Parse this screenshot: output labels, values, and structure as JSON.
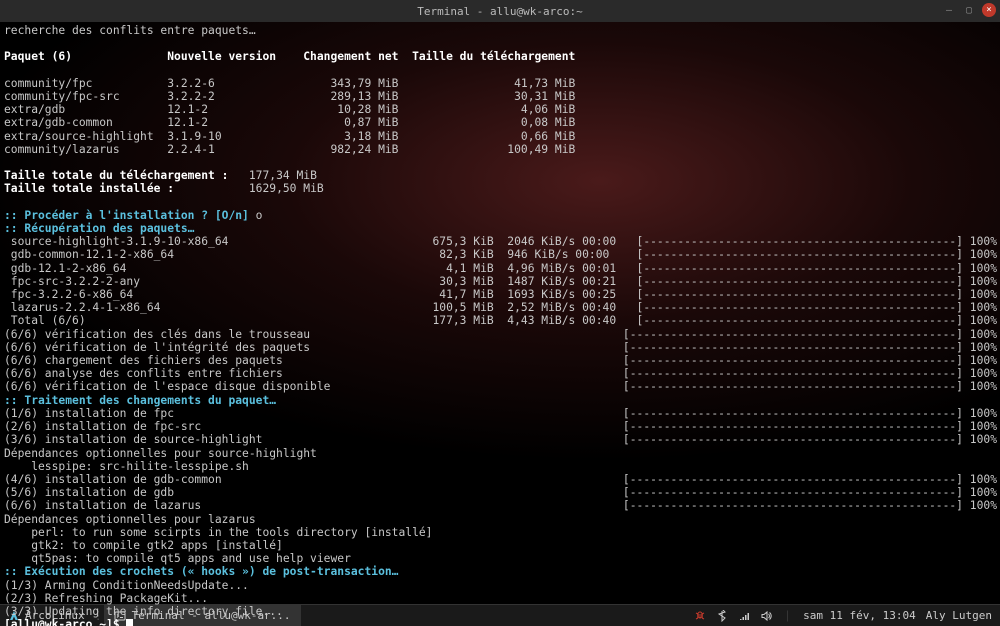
{
  "window_title": "Terminal - allu@wk-arco:~",
  "search_line": "recherche des conflits entre paquets…",
  "pkg_table": {
    "header": [
      "Paquet (6)",
      "Nouvelle version",
      "Changement net",
      "Taille du téléchargement"
    ],
    "rows": [
      [
        "community/fpc",
        "3.2.2-6",
        "343,79 MiB",
        "41,73 MiB"
      ],
      [
        "community/fpc-src",
        "3.2.2-2",
        "289,13 MiB",
        "30,31 MiB"
      ],
      [
        "extra/gdb",
        "12.1-2",
        "10,28 MiB",
        "4,06 MiB"
      ],
      [
        "extra/gdb-common",
        "12.1-2",
        "0,87 MiB",
        "0,08 MiB"
      ],
      [
        "extra/source-highlight",
        "3.1.9-10",
        "3,18 MiB",
        "0,66 MiB"
      ],
      [
        "community/lazarus",
        "2.2.4-1",
        "982,24 MiB",
        "100,49 MiB"
      ]
    ]
  },
  "totals": [
    [
      "Taille totale du téléchargement :",
      "177,34 MiB"
    ],
    [
      "Taille totale installée :",
      "1629,50 MiB"
    ]
  ],
  "prompt_install": ":: Procéder à l'installation ? [O/n] ",
  "prompt_answer": "o",
  "retrieval_header": ":: Récupération des paquets…",
  "downloads": [
    [
      "source-highlight-3.1.9-10-x86_64",
      "675,3 KiB",
      "2046 KiB/s 00:00"
    ],
    [
      "gdb-common-12.1-2-x86_64",
      "82,3 KiB",
      "946 KiB/s 00:00"
    ],
    [
      "gdb-12.1-2-x86_64",
      "4,1 MiB",
      "4,96 MiB/s 00:01"
    ],
    [
      "fpc-src-3.2.2-2-any",
      "30,3 MiB",
      "1487 KiB/s 00:21"
    ],
    [
      "fpc-3.2.2-6-x86_64",
      "41,7 MiB",
      "1693 KiB/s 00:25"
    ],
    [
      "lazarus-2.2.4-1-x86_64",
      "100,5 MiB",
      "2,52 MiB/s 00:40"
    ],
    [
      "Total (6/6)",
      "177,3 MiB",
      "4,43 MiB/s 00:40"
    ]
  ],
  "checks": [
    "(6/6) vérification des clés dans le trousseau",
    "(6/6) vérification de l'intégrité des paquets",
    "(6/6) chargement des fichiers des paquets",
    "(6/6) analyse des conflits entre fichiers",
    "(6/6) vérification de l'espace disque disponible"
  ],
  "treatment_header": ":: Traitement des changements du paquet…",
  "installs1": [
    "(1/6) installation de fpc",
    "(2/6) installation de fpc-src",
    "(3/6) installation de source-highlight"
  ],
  "optdep_sh": [
    "Dépendances optionnelles pour source-highlight",
    "    lesspipe: src-hilite-lesspipe.sh"
  ],
  "installs2": [
    "(4/6) installation de gdb-common",
    "(5/6) installation de gdb",
    "(6/6) installation de lazarus"
  ],
  "optdep_laz": [
    "Dépendances optionnelles pour lazarus",
    "    perl: to run some scirpts in the tools directory [installé]",
    "    gtk2: to compile gtk2 apps [installé]",
    "    qt5pas: to compile qt5 apps and use help viewer"
  ],
  "hooks_header": ":: Exécution des crochets (« hooks ») de post-transaction…",
  "hooks": [
    "(1/3) Arming ConditionNeedsUpdate...",
    "(2/3) Refreshing PackageKit...",
    "(3/3) Updating the info directory file..."
  ],
  "shell_prompt": "[allu@wk-arco ~]$ ",
  "taskbar": {
    "arcolinux": "ArcoLinux",
    "terminal": "Terminal - allu@wk-ar...",
    "clock": "sam 11 fév, 13:04",
    "user": "Aly Lutgen"
  }
}
